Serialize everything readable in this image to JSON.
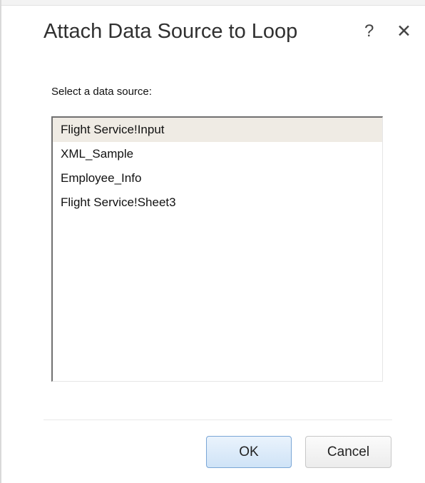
{
  "dialog": {
    "title": "Attach Data Source to Loop",
    "help_label": "?",
    "close_label": "✕",
    "prompt": "Select a data source:",
    "items": [
      {
        "label": "Flight Service!Input",
        "selected": true
      },
      {
        "label": "XML_Sample",
        "selected": false
      },
      {
        "label": "Employee_Info",
        "selected": false
      },
      {
        "label": "Flight Service!Sheet3",
        "selected": false
      }
    ],
    "ok_label": "OK",
    "cancel_label": "Cancel"
  },
  "colors": {
    "selected_row": "#efebe4",
    "ok_border": "#7aa6d6"
  }
}
